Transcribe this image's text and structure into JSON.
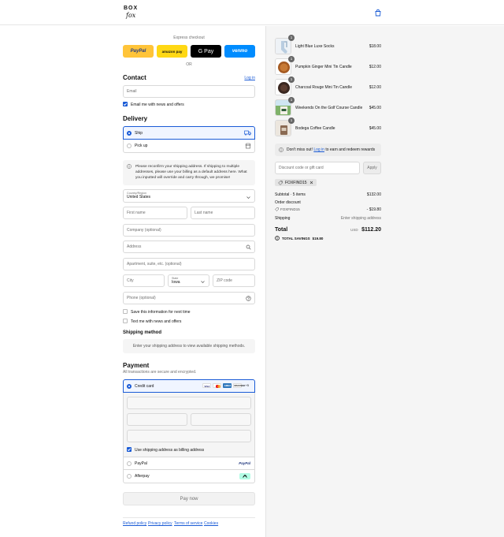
{
  "brand": {
    "line1": "BOX",
    "line2": "fox"
  },
  "express": {
    "title": "Express checkout",
    "buttons": [
      {
        "label": "PayPal",
        "bg": "#ffc439",
        "fg": "#253b80"
      },
      {
        "label": "amazon pay",
        "bg": "#ffd814",
        "fg": "#111111"
      },
      {
        "label": "G Pay",
        "bg": "#000000",
        "fg": "#ffffff"
      },
      {
        "label": "venmo",
        "bg": "#008cff",
        "fg": "#ffffff"
      }
    ],
    "or": "OR"
  },
  "contact": {
    "heading": "Contact",
    "login": "Log in",
    "email_placeholder": "Email",
    "email_news": "Email me with news and offers"
  },
  "delivery": {
    "heading": "Delivery",
    "ship": "Ship",
    "pickup": "Pick up",
    "notice": "Please reconfirm your shipping address. If shipping to multiple addresses, please use your billing as a default address here. What you inputted will override and carry through, we promise!",
    "country_label": "Country/Region",
    "country_value": "United States",
    "first_name": "First name",
    "last_name": "Last name",
    "company": "Company (optional)",
    "address": "Address",
    "apartment": "Apartment, suite, etc. (optional)",
    "city": "City",
    "state_label": "State",
    "state_value": "Iowa",
    "zip": "ZIP code",
    "phone": "Phone (optional)",
    "save_info": "Save this information for next time",
    "text_news": "Text me with news and offers"
  },
  "shipping_method": {
    "heading": "Shipping method",
    "empty": "Enter your shipping address to view available shipping methods."
  },
  "payment": {
    "heading": "Payment",
    "subtitle": "All transactions are secure and encrypted.",
    "credit_card": "Credit card",
    "card_logos": [
      "VISA",
      "MC",
      "AMEX",
      "DISCOVER"
    ],
    "more_cards": "+5",
    "billing_same": "Use shipping address as billing address",
    "paypal": "PayPal",
    "paypal_logo": "PayPal",
    "afterpay": "Afterpay",
    "pay_now": "Pay now"
  },
  "footer": {
    "links": [
      "Refund policy",
      "Privacy policy",
      "Terms of service",
      "Cookies"
    ]
  },
  "cart": {
    "items": [
      {
        "qty": "1",
        "name": "Light Blue Luxe Socks",
        "price": "$18.00"
      },
      {
        "qty": "1",
        "name": "Pumpkin Ginger Mini Tin Candle",
        "price": "$12.00"
      },
      {
        "qty": "1",
        "name": "Charcoal Rouge Mini Tin Candle",
        "price": "$12.00"
      },
      {
        "qty": "1",
        "name": "Weekends On the Golf Course Candle",
        "price": "$45.00"
      },
      {
        "qty": "1",
        "name": "Bodega Coffee Candle",
        "price": "$45.00"
      }
    ],
    "rewards_prefix": "Don't miss out!",
    "rewards_link": "Log in",
    "rewards_suffix": "to earn and redeem rewards",
    "discount_placeholder": "Discount code or gift card",
    "apply": "Apply",
    "applied_code": "FOXFIND15",
    "subtotal_label": "Subtotal · 5 items",
    "subtotal_value": "$132.00",
    "order_discount_label": "Order discount",
    "order_discount_code": "FOXFIND15",
    "order_discount_value": "- $19.80",
    "shipping_label": "Shipping",
    "shipping_value": "Enter shipping address",
    "total_label": "Total",
    "currency": "USD",
    "total_value": "$112.20",
    "savings_label": "TOTAL SAVINGS",
    "savings_value": "$19.80"
  },
  "colors": {
    "accent": "#1a5bd6",
    "sidebar_bg": "#f5f5f5"
  }
}
